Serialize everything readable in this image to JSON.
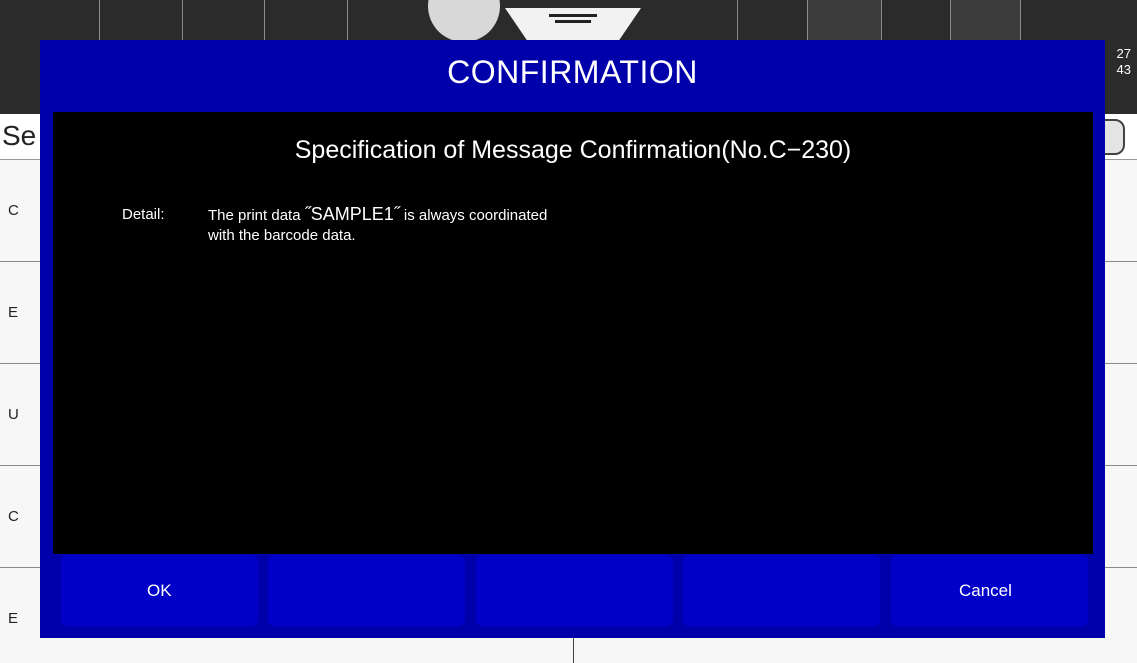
{
  "background": {
    "clock": {
      "line1": "27",
      "line2": "43"
    },
    "list_header": {
      "label": "Se"
    },
    "rows": [
      "C",
      "E",
      "U",
      "C",
      "E"
    ]
  },
  "dialog": {
    "title": "CONFIRMATION",
    "subtitle": "Specification of Message Confirmation(No.C−230)",
    "detail_label": "Detail:",
    "detail_line1_prefix": "The print data ",
    "detail_data_name": "˝SAMPLE1˝",
    "detail_line1_suffix": " is always coordinated",
    "detail_line2": "with the barcode data.",
    "buttons": [
      {
        "label": "OK"
      },
      {
        "label": ""
      },
      {
        "label": ""
      },
      {
        "label": ""
      },
      {
        "label": "Cancel"
      }
    ]
  },
  "colors": {
    "dialog_frame": "#0000aa",
    "button": "#0000c8",
    "body": "#000000"
  }
}
